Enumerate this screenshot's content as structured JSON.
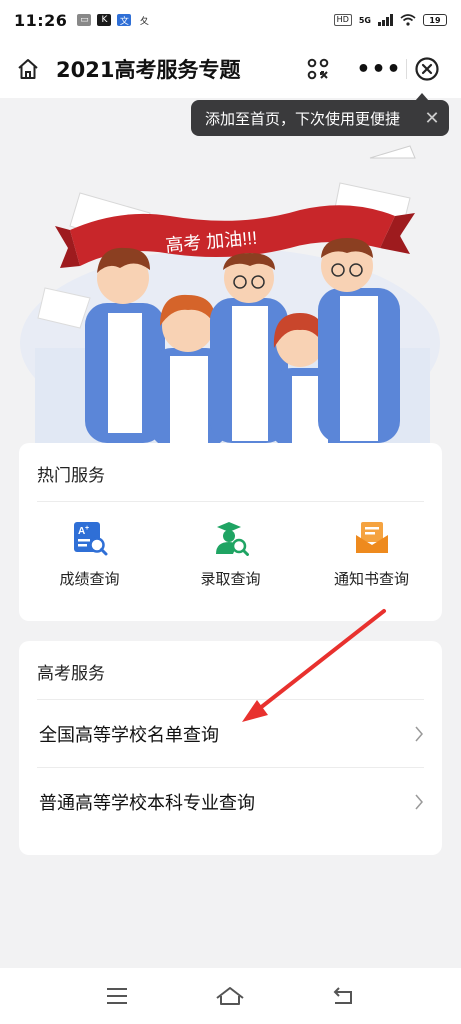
{
  "status_bar": {
    "time": "11:26",
    "network": "5G",
    "hd": "HD",
    "battery": "19"
  },
  "nav": {
    "title": "2021高考服务专题",
    "icons": [
      "home-icon",
      "scan-icon",
      "more-icon",
      "close-icon"
    ]
  },
  "tooltip": {
    "text": "添加至首页，下次使用更便捷"
  },
  "hero": {
    "banner_text": "高考 加油!!!"
  },
  "hot_services": {
    "title": "热门服务",
    "items": [
      {
        "label": "成绩查询",
        "icon": "score-query-icon"
      },
      {
        "label": "录取查询",
        "icon": "admission-query-icon"
      },
      {
        "label": "通知书查询",
        "icon": "notice-letter-icon"
      }
    ]
  },
  "gaokao_services": {
    "title": "高考服务",
    "items": [
      {
        "label": "全国高等学校名单查询"
      },
      {
        "label": "普通高等学校本科专业查询"
      }
    ]
  },
  "colors": {
    "accent_blue": "#2f6fd6",
    "accent_green": "#1fa463",
    "accent_orange": "#f5a340",
    "banner_red": "#c8262a",
    "arrow_red": "#e8312e"
  }
}
